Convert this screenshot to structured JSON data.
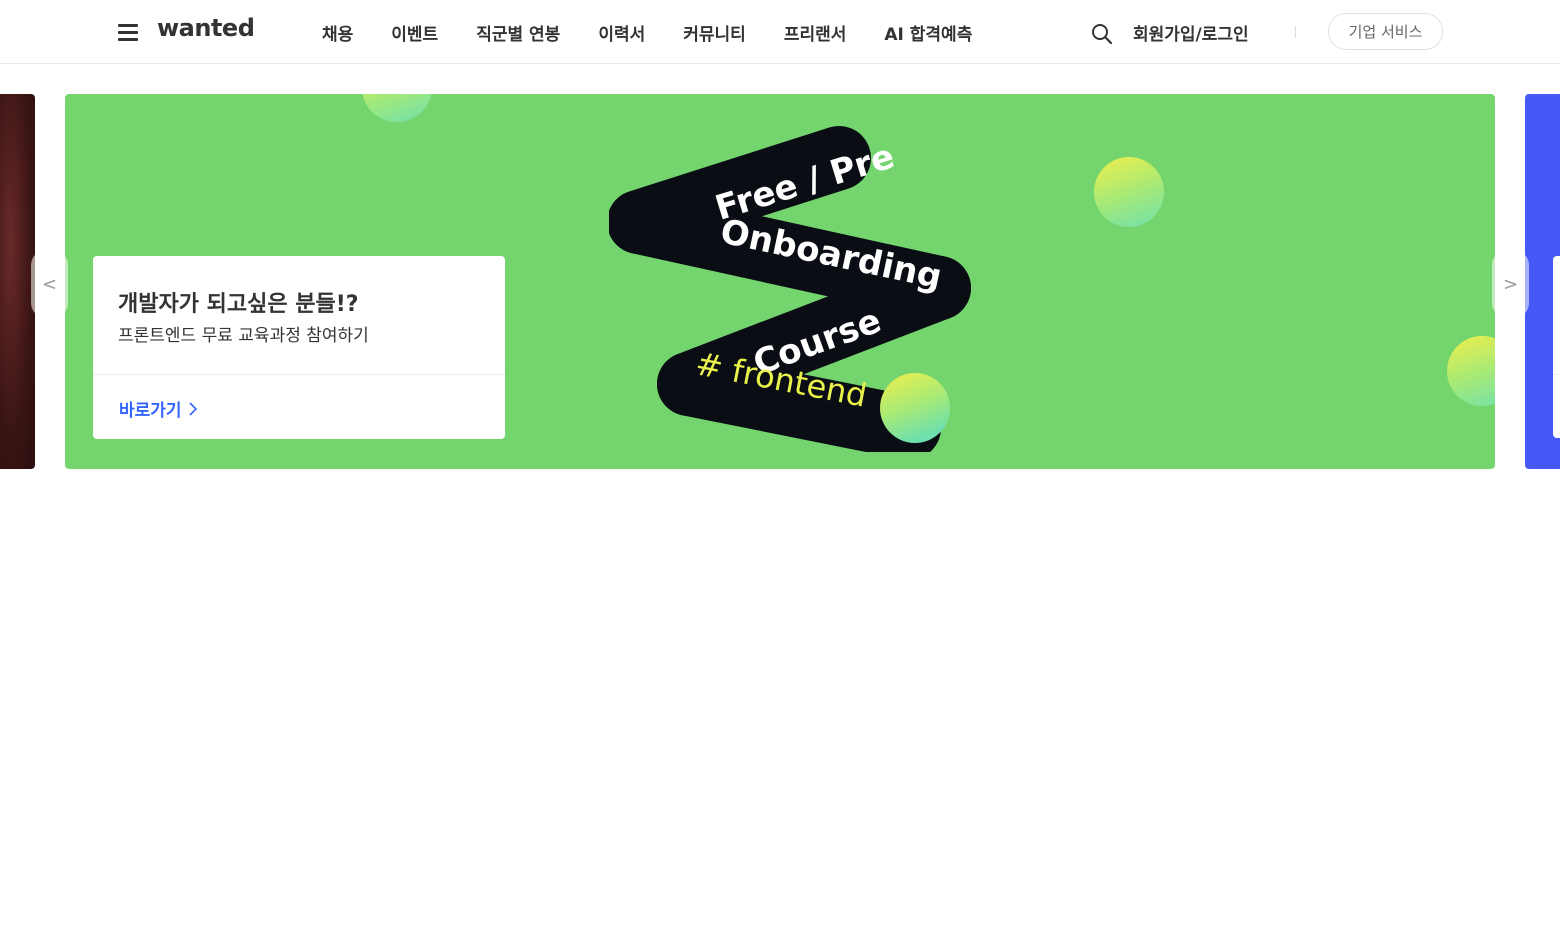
{
  "header": {
    "logo": "wanted",
    "nav": [
      "채용",
      "이벤트",
      "직군별 연봉",
      "이력서",
      "커뮤니티",
      "프리랜서",
      "AI 합격예측"
    ],
    "login": "회원가입/로그인",
    "biz_service": "기업 서비스"
  },
  "banner": {
    "art_lines": [
      "Free / Pre",
      "Onboarding",
      "Course",
      "# frontend"
    ],
    "card": {
      "title": "개발자가 되고싶은 분들!?",
      "subtitle": "프론트엔드 무료 교육과정 참여하기",
      "link": "바로가기"
    },
    "prev_arrow": "<",
    "next_arrow": ">"
  },
  "colors": {
    "banner_bg": "#74d56e",
    "link": "#3366ff",
    "next_slide": "#4658f5",
    "accent_yellow": "#e9f24a"
  }
}
